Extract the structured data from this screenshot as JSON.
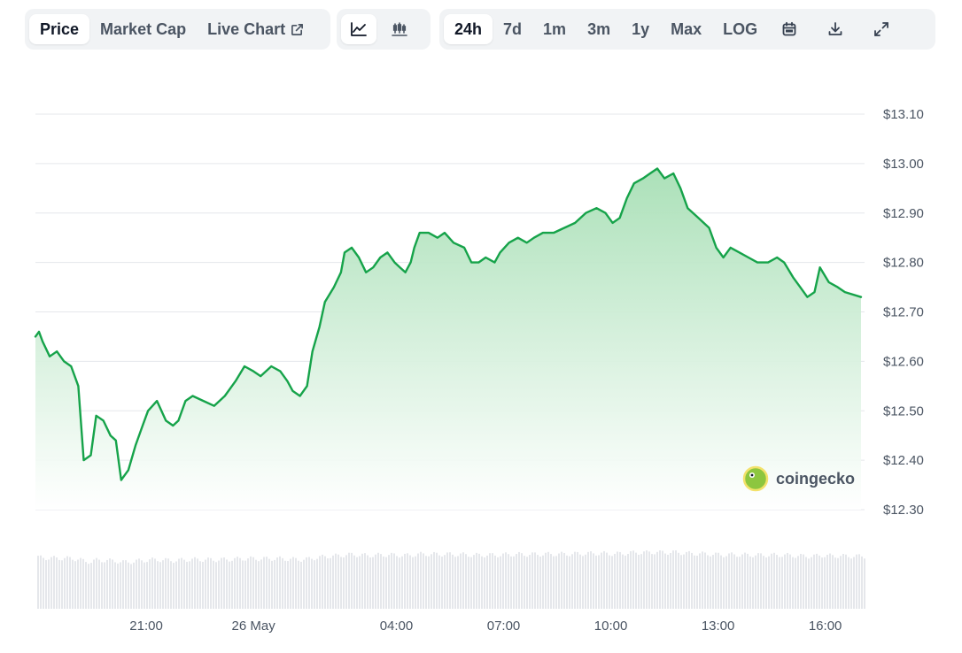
{
  "toolbar": {
    "view_tabs": [
      {
        "label": "Price",
        "active": true
      },
      {
        "label": "Market Cap",
        "active": false
      },
      {
        "label": "Live Chart",
        "active": false,
        "icon": "external-link-icon"
      }
    ],
    "chart_type_buttons": [
      {
        "icon": "line-chart-icon",
        "active": true
      },
      {
        "icon": "candlestick-icon",
        "active": false
      }
    ],
    "ranges": [
      {
        "label": "24h",
        "active": true
      },
      {
        "label": "7d",
        "active": false
      },
      {
        "label": "1m",
        "active": false
      },
      {
        "label": "3m",
        "active": false
      },
      {
        "label": "1y",
        "active": false
      },
      {
        "label": "Max",
        "active": false
      },
      {
        "label": "LOG",
        "active": false
      }
    ],
    "tool_icons": [
      "calendar-icon",
      "download-icon",
      "fullscreen-icon"
    ]
  },
  "watermark": {
    "text": "coingecko"
  },
  "colors": {
    "line": "#16a34a",
    "fill_top": "#b7e4c1",
    "grid": "#e5e7eb",
    "volume": "#e5e7eb"
  },
  "chart_data": {
    "type": "area",
    "title": "",
    "xlabel": "",
    "ylabel": "",
    "y_ticks": [
      "$13.10",
      "$13.00",
      "$12.90",
      "$12.80",
      "$12.70",
      "$12.60",
      "$12.50",
      "$12.40",
      "$12.30"
    ],
    "y_tick_values": [
      13.1,
      13.0,
      12.9,
      12.8,
      12.7,
      12.6,
      12.5,
      12.4,
      12.3
    ],
    "ylim": [
      12.3,
      13.1
    ],
    "x_tick_labels": [
      "21:00",
      "26 May",
      "04:00",
      "07:00",
      "10:00",
      "13:00",
      "16:00"
    ],
    "x_tick_hours": [
      21,
      24,
      28,
      31,
      34,
      37,
      40
    ],
    "x_range_hours": [
      17.9,
      41.1
    ],
    "x_unit": "hours since 00:00 on the day before 26 May",
    "grid": true,
    "series": [
      {
        "points": [
          [
            17.9,
            12.65
          ],
          [
            18.0,
            12.66
          ],
          [
            18.1,
            12.64
          ],
          [
            18.3,
            12.61
          ],
          [
            18.5,
            12.62
          ],
          [
            18.7,
            12.6
          ],
          [
            18.9,
            12.59
          ],
          [
            19.1,
            12.55
          ],
          [
            19.25,
            12.4
          ],
          [
            19.45,
            12.41
          ],
          [
            19.6,
            12.49
          ],
          [
            19.8,
            12.48
          ],
          [
            20.0,
            12.45
          ],
          [
            20.15,
            12.44
          ],
          [
            20.3,
            12.36
          ],
          [
            20.5,
            12.38
          ],
          [
            20.7,
            12.43
          ],
          [
            20.9,
            12.47
          ],
          [
            21.05,
            12.5
          ],
          [
            21.3,
            12.52
          ],
          [
            21.55,
            12.48
          ],
          [
            21.75,
            12.47
          ],
          [
            21.9,
            12.48
          ],
          [
            22.1,
            12.52
          ],
          [
            22.3,
            12.53
          ],
          [
            22.6,
            12.52
          ],
          [
            22.9,
            12.51
          ],
          [
            23.2,
            12.53
          ],
          [
            23.5,
            12.56
          ],
          [
            23.75,
            12.59
          ],
          [
            24.0,
            12.58
          ],
          [
            24.2,
            12.57
          ],
          [
            24.5,
            12.59
          ],
          [
            24.75,
            12.58
          ],
          [
            24.95,
            12.56
          ],
          [
            25.1,
            12.54
          ],
          [
            25.3,
            12.53
          ],
          [
            25.5,
            12.55
          ],
          [
            25.65,
            12.62
          ],
          [
            25.85,
            12.67
          ],
          [
            26.0,
            12.72
          ],
          [
            26.25,
            12.75
          ],
          [
            26.45,
            12.78
          ],
          [
            26.55,
            12.82
          ],
          [
            26.75,
            12.83
          ],
          [
            26.95,
            12.81
          ],
          [
            27.15,
            12.78
          ],
          [
            27.35,
            12.79
          ],
          [
            27.55,
            12.81
          ],
          [
            27.75,
            12.82
          ],
          [
            27.95,
            12.8
          ],
          [
            28.1,
            12.79
          ],
          [
            28.25,
            12.78
          ],
          [
            28.4,
            12.8
          ],
          [
            28.5,
            12.83
          ],
          [
            28.65,
            12.86
          ],
          [
            28.9,
            12.86
          ],
          [
            29.15,
            12.85
          ],
          [
            29.35,
            12.86
          ],
          [
            29.6,
            12.84
          ],
          [
            29.9,
            12.83
          ],
          [
            30.1,
            12.8
          ],
          [
            30.3,
            12.8
          ],
          [
            30.5,
            12.81
          ],
          [
            30.75,
            12.8
          ],
          [
            30.9,
            12.82
          ],
          [
            31.15,
            12.84
          ],
          [
            31.4,
            12.85
          ],
          [
            31.65,
            12.84
          ],
          [
            31.85,
            12.85
          ],
          [
            32.1,
            12.86
          ],
          [
            32.4,
            12.86
          ],
          [
            32.7,
            12.87
          ],
          [
            33.0,
            12.88
          ],
          [
            33.3,
            12.9
          ],
          [
            33.6,
            12.91
          ],
          [
            33.85,
            12.9
          ],
          [
            34.05,
            12.88
          ],
          [
            34.25,
            12.89
          ],
          [
            34.45,
            12.93
          ],
          [
            34.65,
            12.96
          ],
          [
            34.9,
            12.97
          ],
          [
            35.1,
            12.98
          ],
          [
            35.3,
            12.99
          ],
          [
            35.5,
            12.97
          ],
          [
            35.75,
            12.98
          ],
          [
            35.95,
            12.95
          ],
          [
            36.15,
            12.91
          ],
          [
            36.45,
            12.89
          ],
          [
            36.75,
            12.87
          ],
          [
            36.95,
            12.83
          ],
          [
            37.15,
            12.81
          ],
          [
            37.35,
            12.83
          ],
          [
            37.6,
            12.82
          ],
          [
            37.85,
            12.81
          ],
          [
            38.1,
            12.8
          ],
          [
            38.4,
            12.8
          ],
          [
            38.65,
            12.81
          ],
          [
            38.85,
            12.8
          ],
          [
            39.1,
            12.77
          ],
          [
            39.3,
            12.75
          ],
          [
            39.5,
            12.73
          ],
          [
            39.7,
            12.74
          ],
          [
            39.85,
            12.79
          ],
          [
            40.1,
            12.76
          ],
          [
            40.35,
            12.75
          ],
          [
            40.55,
            12.74
          ],
          [
            41.0,
            12.73
          ]
        ]
      }
    ]
  }
}
